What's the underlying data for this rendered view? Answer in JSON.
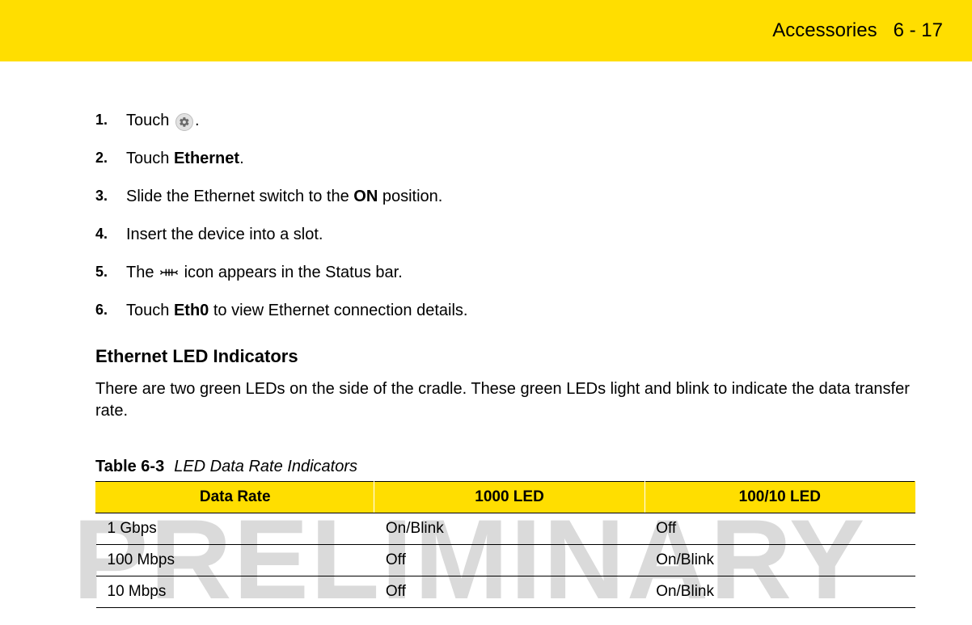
{
  "header": {
    "section": "Accessories",
    "page": "6 - 17"
  },
  "steps": [
    {
      "pre": "Touch ",
      "icon": "gear",
      "post": "."
    },
    {
      "pre": "Touch ",
      "bold": "Ethernet",
      "post": "."
    },
    {
      "pre": "Slide the Ethernet switch to the ",
      "bold": "ON",
      "post": " position."
    },
    {
      "pre": "Insert the device into a slot."
    },
    {
      "pre": "The ",
      "icon": "ethernet",
      "post": " icon appears in the Status bar."
    },
    {
      "pre": "Touch ",
      "bold": "Eth0",
      "post": " to view Ethernet connection details."
    }
  ],
  "subsection_title": "Ethernet LED Indicators",
  "subsection_body": "There are two green LEDs on the side of the cradle. These green LEDs light and blink to indicate the data transfer rate.",
  "table": {
    "number": "Table 6-3",
    "title": "LED Data Rate Indicators",
    "columns": [
      "Data Rate",
      "1000 LED",
      "100/10 LED"
    ],
    "rows": [
      [
        "1 Gbps",
        "On/Blink",
        "Off"
      ],
      [
        "100 Mbps",
        "Off",
        "On/Blink"
      ],
      [
        "10 Mbps",
        "Off",
        "On/Blink"
      ]
    ]
  },
  "watermark": "PRELIMINARY"
}
